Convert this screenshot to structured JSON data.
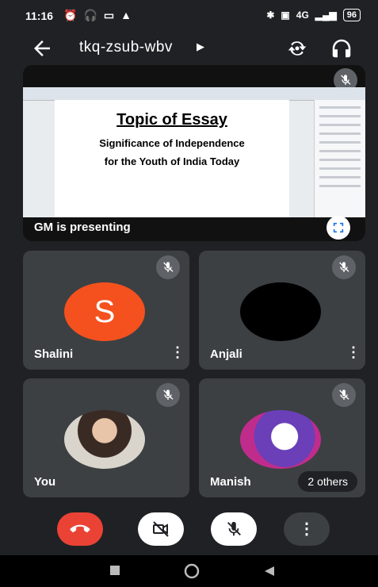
{
  "status": {
    "time": "11:16",
    "battery": "96",
    "network": "4G"
  },
  "meeting": {
    "code": "tkq-zsub-wbv"
  },
  "presentation": {
    "label": "GM is presenting",
    "slide_title": "Topic of Essay",
    "slide_line1": "Significance of Independence",
    "slide_line2": "for the Youth of India Today"
  },
  "participants": [
    {
      "name": "Shalini",
      "initial": "S"
    },
    {
      "name": "Anjali"
    },
    {
      "name": "You"
    },
    {
      "name": "Manish"
    }
  ],
  "others_label": "2 others",
  "colors": {
    "background": "#202124",
    "tile": "#3c4043",
    "end_call": "#ea4335",
    "avatar_shalini": "#f4511e"
  }
}
